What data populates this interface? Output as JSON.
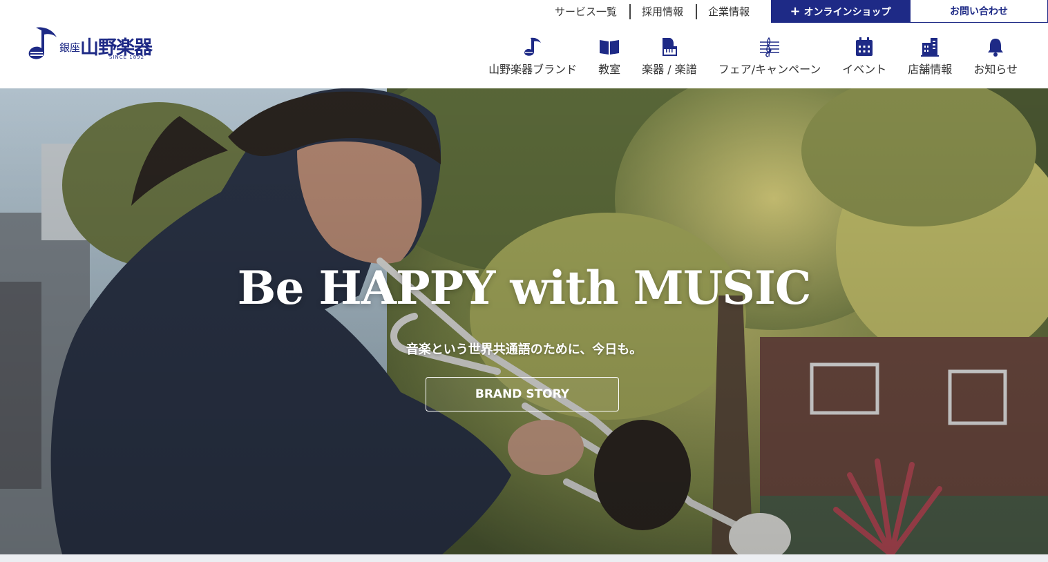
{
  "logo": {
    "ginza": "銀座",
    "name": "山野楽器",
    "since": "SINCE 1892"
  },
  "utility_nav": {
    "links": [
      "サービス一覧",
      "採用情報",
      "企業情報"
    ],
    "online_shop": "オンラインショップ",
    "contact": "お問い合わせ"
  },
  "main_nav": [
    {
      "label": "山野楽器ブランド",
      "icon": "brand-note-icon"
    },
    {
      "label": "教室",
      "icon": "book-icon"
    },
    {
      "label": "楽器 / 楽譜",
      "icon": "piano-icon"
    },
    {
      "label": "フェア/キャンペーン",
      "icon": "music-staff-icon"
    },
    {
      "label": "イベント",
      "icon": "calendar-icon"
    },
    {
      "label": "店舗情報",
      "icon": "building-icon"
    },
    {
      "label": "お知らせ",
      "icon": "bell-icon"
    }
  ],
  "hero": {
    "title": "Be HAPPY with MUSIC",
    "subtitle": "音楽という世界共通語のために、今日も。",
    "button": "BRAND STORY"
  },
  "colors": {
    "brand_navy": "#1e2a86",
    "nav_icon": "#1e2a86"
  }
}
